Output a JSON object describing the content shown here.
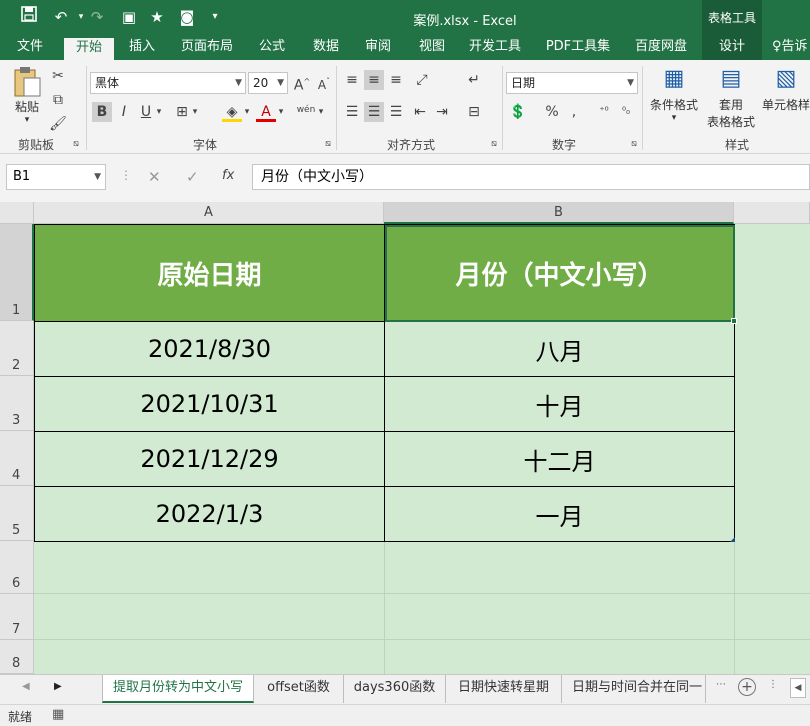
{
  "window": {
    "title": "案例.xlsx - Excel",
    "context_tab_title": "表格工具"
  },
  "quick_access": {
    "save_icon": "save-icon",
    "undo_icon": "undo-icon",
    "redo_icon": "redo-icon"
  },
  "ribbon_tabs": [
    {
      "label": "文件"
    },
    {
      "label": "开始"
    },
    {
      "label": "插入"
    },
    {
      "label": "页面布局"
    },
    {
      "label": "公式"
    },
    {
      "label": "数据"
    },
    {
      "label": "审阅"
    },
    {
      "label": "视图"
    },
    {
      "label": "开发工具"
    },
    {
      "label": "PDF工具集"
    },
    {
      "label": "百度网盘"
    },
    {
      "label": "设计"
    },
    {
      "label": "告诉"
    }
  ],
  "ribbon": {
    "clipboard": {
      "paste_label": "粘贴",
      "group_label": "剪贴板"
    },
    "font": {
      "font_name": "黑体",
      "font_size": "20",
      "group_label": "字体",
      "bold": "B",
      "italic": "I",
      "underline": "U",
      "font_color_letter": "A",
      "phonetic": "wén"
    },
    "alignment": {
      "group_label": "对齐方式"
    },
    "number": {
      "format": "日期",
      "group_label": "数字",
      "percent": "%",
      "comma": ","
    },
    "styles": {
      "conditional_label": "条件格式",
      "table_label_1": "套用",
      "table_label_2": "表格格式",
      "cell_styles_label": "单元格样",
      "group_label": "样式"
    }
  },
  "formula_bar": {
    "name_box": "B1",
    "fx_label": "fx",
    "formula": "月份（中文小写）"
  },
  "columns": [
    {
      "label": "A"
    },
    {
      "label": "B"
    }
  ],
  "rows": [
    "1",
    "2",
    "3",
    "4",
    "5",
    "6",
    "7",
    "8"
  ],
  "table": {
    "headers": [
      "原始日期",
      "月份（中文小写）"
    ],
    "rows": [
      [
        "2021/8/30",
        "八月"
      ],
      [
        "2021/10/31",
        "十月"
      ],
      [
        "2021/12/29",
        "十二月"
      ],
      [
        "2022/1/3",
        "一月"
      ]
    ]
  },
  "sheet_tabs": [
    {
      "label": "提取月份转为中文小写"
    },
    {
      "label": "offset函数"
    },
    {
      "label": "days360函数"
    },
    {
      "label": "日期快速转星期"
    },
    {
      "label": "日期与时间合并在同一"
    }
  ],
  "status": {
    "ready": "就绪"
  },
  "colors": {
    "excel_green": "#217346",
    "header_fill": "#70ad47",
    "cell_fill": "#d2ead2"
  }
}
